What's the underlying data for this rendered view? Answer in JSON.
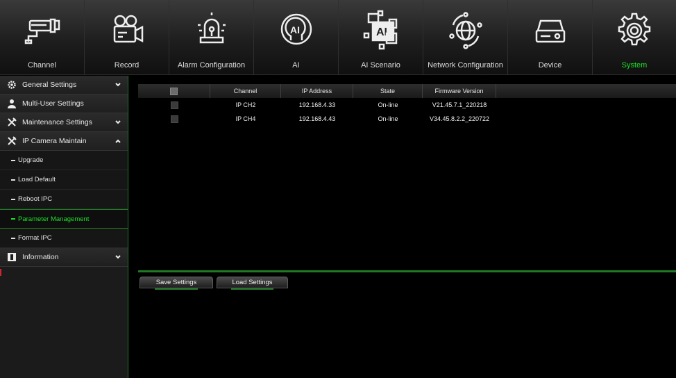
{
  "nav": {
    "items": [
      {
        "label": "Channel",
        "icon": "cctv-camera-icon"
      },
      {
        "label": "Record",
        "icon": "film-camera-icon"
      },
      {
        "label": "Alarm Configuration",
        "icon": "alarm-light-icon"
      },
      {
        "label": "AI",
        "icon": "ai-head-icon"
      },
      {
        "label": "AI Scenario",
        "icon": "ai-scenario-icon"
      },
      {
        "label": "Network Configuration",
        "icon": "globe-network-icon"
      },
      {
        "label": "Device",
        "icon": "hard-drive-icon"
      },
      {
        "label": "System",
        "icon": "gear-icon"
      }
    ],
    "active": "System",
    "active_color": "#1ee028"
  },
  "sidebar": {
    "general": "General Settings",
    "multiuser": "Multi-User Settings",
    "maintenance": "Maintenance Settings",
    "ipcam": "IP Camera Maintain",
    "sub": {
      "upgrade": "Upgrade",
      "load_default": "Load Default",
      "reboot": "Reboot IPC",
      "param": "Parameter Management",
      "format": "Format IPC"
    },
    "information": "Information"
  },
  "table": {
    "headers": [
      "Channel",
      "IP Address",
      "State",
      "Firmware Version"
    ],
    "rows": [
      {
        "channel": "IP CH2",
        "ip": "192.168.4.33",
        "state": "On-line",
        "firmware": "V21.45.7.1_220218"
      },
      {
        "channel": "IP CH4",
        "ip": "192.168.4.43",
        "state": "On-line",
        "firmware": "V34.45.8.2.2_220722"
      }
    ]
  },
  "buttons": {
    "save": "Save Settings",
    "load": "Load Settings"
  },
  "colors": {
    "accent": "#1ee028",
    "divider": "#1f7a24",
    "marker": "#d0242f"
  }
}
